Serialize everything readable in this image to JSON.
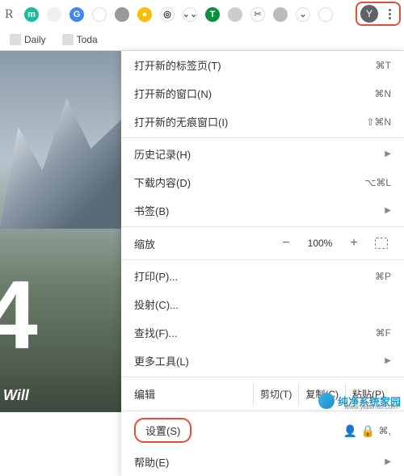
{
  "toolbar": {
    "partial": "R",
    "avatar": "Y"
  },
  "extensions": [
    {
      "name": "ext-teal",
      "bg": "#1abc9c",
      "txt": "m",
      "col": "#fff"
    },
    {
      "name": "ext-blank1",
      "bg": "#f0f0f0",
      "txt": "",
      "col": "#fff"
    },
    {
      "name": "ext-translate",
      "bg": "#4285f4",
      "txt": "G",
      "col": "#fff"
    },
    {
      "name": "ext-blank2",
      "bg": "#fff",
      "txt": "",
      "col": "#fff"
    },
    {
      "name": "ext-gray1",
      "bg": "#999",
      "txt": "",
      "col": "#fff"
    },
    {
      "name": "ext-compass",
      "bg": "#fbbc04",
      "txt": "●",
      "col": "#fff"
    },
    {
      "name": "ext-target",
      "bg": "#fff",
      "txt": "◎",
      "col": "#333"
    },
    {
      "name": "ext-chevrons",
      "bg": "#fff",
      "txt": "⌄⌄",
      "col": "#666"
    },
    {
      "name": "ext-shield",
      "bg": "#0a8f3c",
      "txt": "T",
      "col": "#fff"
    },
    {
      "name": "ext-gray2",
      "bg": "#ccc",
      "txt": "",
      "col": "#fff"
    },
    {
      "name": "ext-clip",
      "bg": "#fff",
      "txt": "✂",
      "col": "#888"
    },
    {
      "name": "ext-gray3",
      "bg": "#bbb",
      "txt": "",
      "col": "#fff"
    },
    {
      "name": "ext-pocket",
      "bg": "#fff",
      "txt": "⌄",
      "col": "#666"
    },
    {
      "name": "ext-blank3",
      "bg": "#fff",
      "txt": "",
      "col": "#fff"
    }
  ],
  "bookmarks": [
    {
      "label": "Daily"
    },
    {
      "label": "Toda"
    }
  ],
  "menu": {
    "new_tab": {
      "label": "打开新的标签页(T)",
      "sc": "⌘T"
    },
    "new_window": {
      "label": "打开新的窗口(N)",
      "sc": "⌘N"
    },
    "incognito": {
      "label": "打开新的无痕窗口(I)",
      "sc": "⇧⌘N"
    },
    "history": {
      "label": "历史记录(H)"
    },
    "downloads": {
      "label": "下载内容(D)",
      "sc": "⌥⌘L"
    },
    "bookmarks": {
      "label": "书签(B)"
    },
    "zoom": {
      "label": "缩放",
      "value": "100%",
      "minus": "−",
      "plus": "+"
    },
    "print": {
      "label": "打印(P)...",
      "sc": "⌘P"
    },
    "cast": {
      "label": "投射(C)..."
    },
    "find": {
      "label": "查找(F)...",
      "sc": "⌘F"
    },
    "more_tools": {
      "label": "更多工具(L)"
    },
    "edit": {
      "label": "编辑",
      "cut": "剪切(T)",
      "copy": "复制(C)",
      "paste": "粘贴(P)"
    },
    "settings": {
      "label": "设置(S)",
      "sc": "⌘,"
    },
    "help": {
      "label": "帮助(E)"
    }
  },
  "bg": {
    "num": "4",
    "will": "Will"
  },
  "watermark": {
    "brand": "纯净系统家园",
    "url": "www.yidaimei.com"
  }
}
